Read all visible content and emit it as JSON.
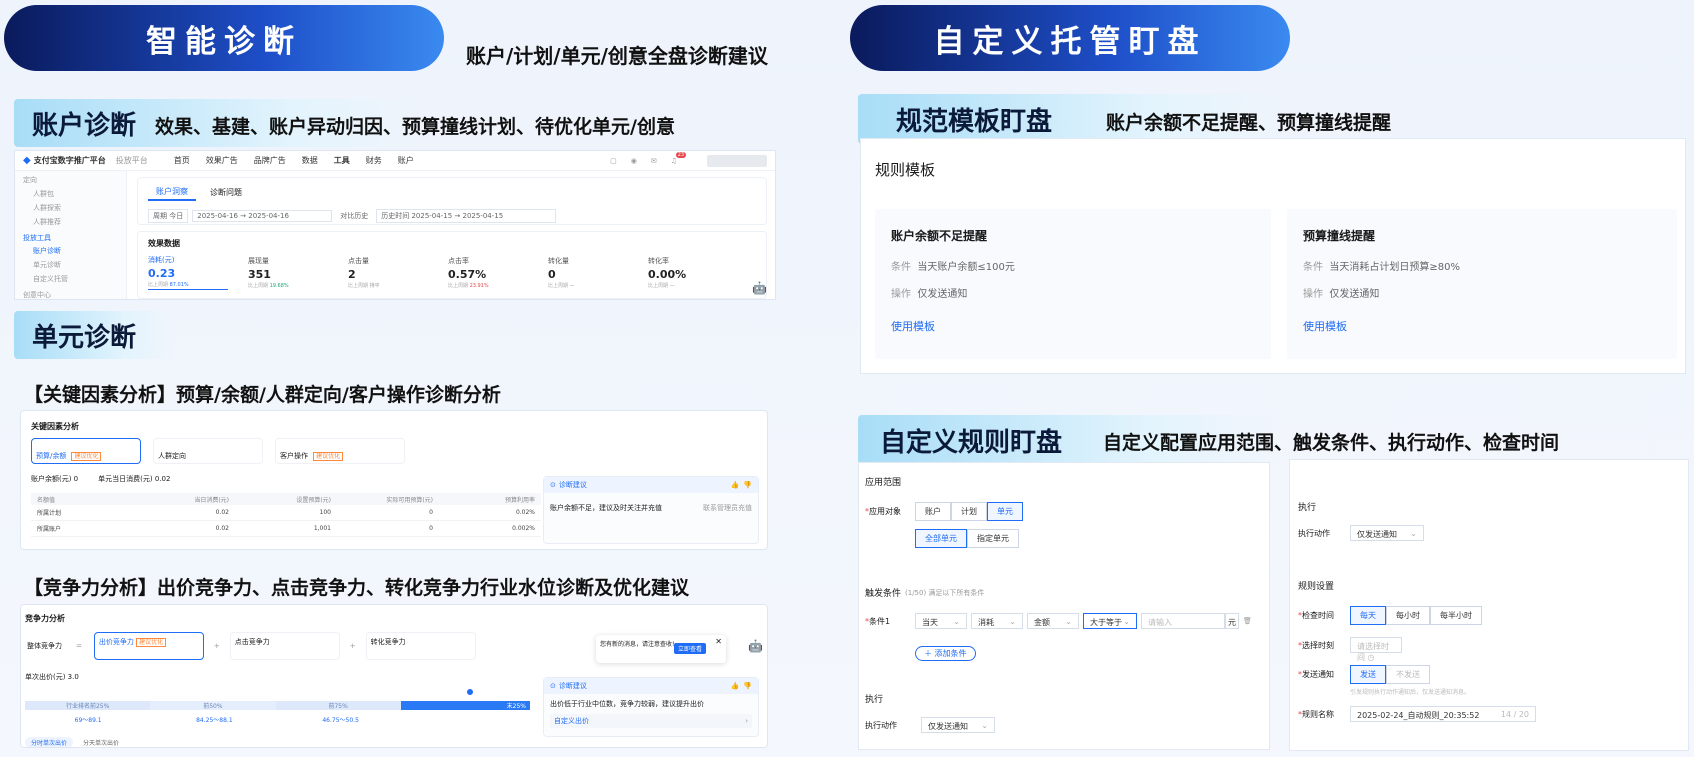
{
  "left": {
    "banner": {
      "title": "智能诊断",
      "subtitle": "账户/计划/单元/创意全盘诊断建议"
    },
    "account": {
      "tag": "账户诊断",
      "desc": "效果、基建、账户异动归因、预算撞线计划、待优化单元/创意",
      "topbar": {
        "brand": "支付宝数字推广平台",
        "platform": "投放平台",
        "nav": [
          "首页",
          "效果广告",
          "品牌广告",
          "数据",
          "工具",
          "财务",
          "账户"
        ],
        "badge": "23"
      },
      "sidebar": [
        "定向",
        "人群包",
        "人群探索",
        "人群推荐",
        "投放工具",
        "账户诊断",
        "单元诊断",
        "自定义托管",
        "创意中心"
      ],
      "tabs": [
        "账户洞察",
        "诊断问题"
      ],
      "filters": {
        "period_label": "周期",
        "period_value": "今日",
        "date_from": "2025-04-16",
        "date_to": "2025-04-16",
        "compare_label": "对比历史",
        "history_label": "历史时间",
        "hist_from": "2025-04-15",
        "hist_to": "2025-04-15"
      },
      "metrics_title": "效果数据",
      "metrics": [
        {
          "label": "消耗(元)",
          "value": "0.23",
          "hint": "比上周期",
          "delta": "87.01%"
        },
        {
          "label": "展现量",
          "value": "351",
          "hint": "比上周期",
          "delta": "19.68%"
        },
        {
          "label": "点击量",
          "value": "2",
          "hint": "比上周期",
          "delta": "持平"
        },
        {
          "label": "点击率",
          "value": "0.57%",
          "hint": "比上周期",
          "delta": "23.91%"
        },
        {
          "label": "转化量",
          "value": "0",
          "hint": "比上周期",
          "delta": "—"
        },
        {
          "label": "转化率",
          "value": "0.00%",
          "hint": "比上周期",
          "delta": "—"
        }
      ]
    },
    "unit": {
      "tag": "单元诊断",
      "key_heading": "【关键因素分析】预算/余额/人群定向/客户操作诊断分析",
      "key_panel": {
        "title": "关键因素分析",
        "cards": [
          {
            "label": "预算/余额",
            "badge": "建议优化"
          },
          {
            "label": "人群定向",
            "badge": ""
          },
          {
            "label": "客户操作",
            "badge": "建议优化"
          }
        ],
        "balance": "账户余额(元)  0",
        "daily": "单元当日消费(元)  0.02",
        "table_head": [
          "名额值",
          "当日消费(元)",
          "设置预算(元)",
          "实际可用预算(元)",
          "预算利用率"
        ],
        "table_rows": [
          [
            "所属计划",
            "0.02",
            "100",
            "0",
            "0.02%"
          ],
          [
            "所属账户",
            "0.02",
            "1,001",
            "0",
            "0.002%"
          ]
        ],
        "suggest_title": "诊断建议",
        "suggest_text": "账户余额不足，建议及时关注并充值",
        "suggest_action": "联系管理员充值"
      },
      "comp_heading": "【竞争力分析】出价竞争力、点击竞争力、转化竞争力行业水位诊断及优化建议",
      "comp_panel": {
        "title": "竞争力分析",
        "overall": "整体竞争力",
        "items": [
          {
            "label": "出价竞争力",
            "badge": "建议优化"
          },
          {
            "label": "点击竞争力",
            "badge": ""
          },
          {
            "label": "转化竞争力",
            "badge": ""
          }
        ],
        "price": "单次出价(元)  3.0",
        "bands": [
          "行业排名前25%",
          "前50%",
          "前75%",
          "末25%"
        ],
        "ranges": [
          "69～89.1",
          "84.25～88.1",
          "46.75～50.5"
        ],
        "tabs": [
          "分时单次出价",
          "分天单次出价"
        ],
        "popup": "您有新的消息，请注意查收!",
        "popup_btn": "立即查看",
        "suggest_title": "诊断建议",
        "suggest_text": "出价低于行业中位数，竞争力较弱，建议提升出价",
        "suggest_link": "自定义出价"
      }
    }
  },
  "right": {
    "banner": {
      "title": "自定义托管盯盘"
    },
    "template": {
      "tag": "规范模板盯盘",
      "desc": "账户余额不足提醒、预算撞线提醒",
      "panel_title": "规则模板",
      "cards": [
        {
          "title": "账户余额不足提醒",
          "cond_label": "条件",
          "cond": "当天账户余额≤100元",
          "op_label": "操作",
          "op": "仅发送通知",
          "link": "使用模板"
        },
        {
          "title": "预算撞线提醒",
          "cond_label": "条件",
          "cond": "当天消耗占计划日预算≥80%",
          "op_label": "操作",
          "op": "仅发送通知",
          "link": "使用模板"
        }
      ]
    },
    "custom": {
      "tag": "自定义规则盯盘",
      "desc": "自定义配置应用范围、触发条件、执行动作、检查时间",
      "scope": {
        "title": "应用范围",
        "target_label": "应用对象",
        "targets": [
          "账户",
          "计划",
          "单元"
        ],
        "units": [
          "全部单元",
          "指定单元"
        ]
      },
      "trigger": {
        "title": "触发条件",
        "hint": "(1/50) 满足以下所有条件",
        "cond_label": "条件1",
        "selects": [
          "当天",
          "消耗",
          "金额",
          "大于等于"
        ],
        "input_ph": "请输入",
        "unit": "元",
        "add": "添加条件"
      },
      "exec_left": {
        "title": "执行",
        "label": "执行动作",
        "value": "仅发送通知"
      },
      "exec_right": {
        "title": "执行",
        "label": "执行动作",
        "value": "仅发送通知"
      },
      "settings": {
        "title": "规则设置",
        "check_label": "检查时间",
        "check_opts": [
          "每天",
          "每小时",
          "每半小时"
        ],
        "time_label": "选择时刻",
        "time_ph": "请选择时间",
        "notify_label": "发送通知",
        "notify_opts": [
          "发送",
          "不发送"
        ],
        "notify_hint": "引发规则执行动作通知后，仅发送通知消息。",
        "name_label": "规则名称",
        "name_value": "2025-02-24_自动规则_20:35:52",
        "name_count": "14 / 20"
      }
    }
  },
  "colors": {
    "accent": "#1f6cf5",
    "navy": "#0a1a5c",
    "badge": "#ff8a3d",
    "up": "#e5484d",
    "down": "#19a974"
  }
}
